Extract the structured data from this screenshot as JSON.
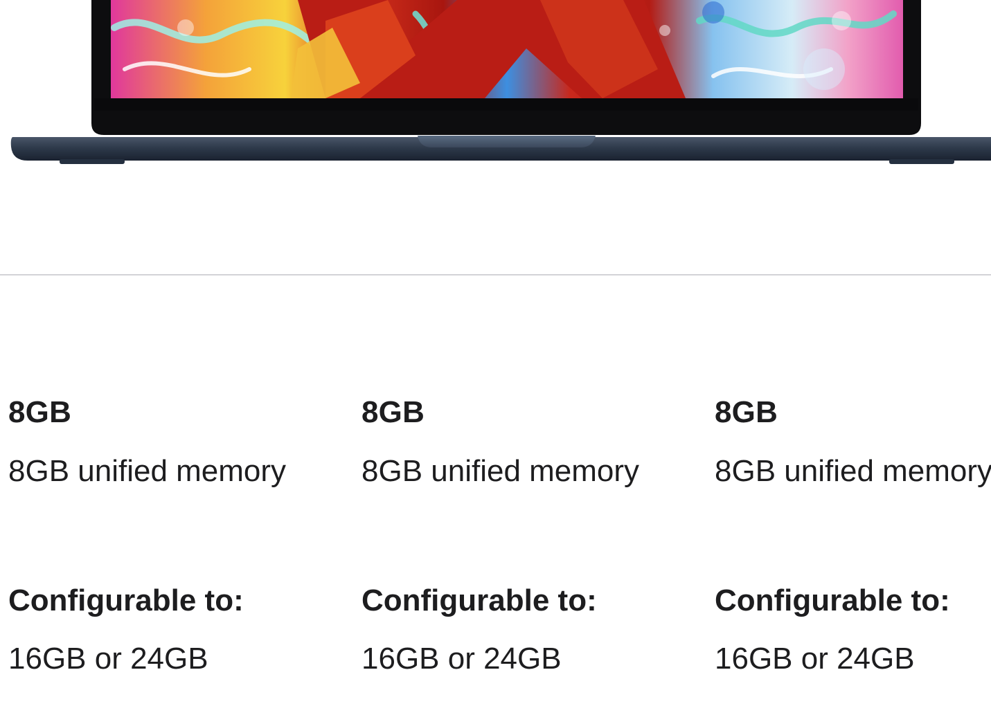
{
  "hero": {
    "image_name": "macbook-air-midnight",
    "colors": {
      "body": "#2e3a4b",
      "bezel": "#0d0d0f",
      "screen_accent_red": "#c8281c",
      "screen_accent_blue": "#3d8fe0",
      "screen_accent_pink": "#e0389c"
    }
  },
  "specs": {
    "columns": [
      {
        "memory_title": "8GB",
        "memory_desc": "8GB unified memory",
        "config_label": "Configurable to:",
        "config_value": "16GB or 24GB"
      },
      {
        "memory_title": "8GB",
        "memory_desc": "8GB unified memory",
        "config_label": "Configurable to:",
        "config_value": "16GB or 24GB"
      },
      {
        "memory_title": "8GB",
        "memory_desc": "8GB unified memory",
        "config_label": "Configurable to:",
        "config_value": "16GB or 24GB"
      }
    ]
  }
}
